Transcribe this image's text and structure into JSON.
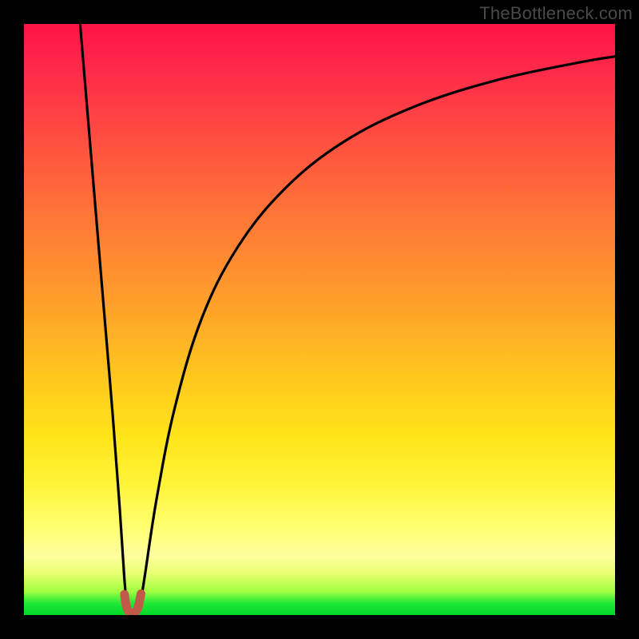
{
  "watermark": "TheBottleneck.com",
  "chart_data": {
    "type": "line",
    "title": "",
    "xlabel": "",
    "ylabel": "",
    "xlim": [
      0,
      100
    ],
    "ylim": [
      0,
      100
    ],
    "background_gradient": {
      "top_color": "#ff1446",
      "mid_color": "#ffe41a",
      "bottom_color": "#00d828",
      "meaning": "bottleneck severity (red=high, green=none)"
    },
    "series": [
      {
        "name": "left-branch",
        "stroke": "#000000",
        "x": [
          9.5,
          10.5,
          12.0,
          13.5,
          15.0,
          16.2,
          17.0,
          17.5
        ],
        "y": [
          100,
          88,
          70,
          52,
          34,
          18,
          6,
          0.5
        ]
      },
      {
        "name": "right-branch",
        "stroke": "#000000",
        "x": [
          19.5,
          20.5,
          22.5,
          25.5,
          30,
          36,
          44,
          54,
          66,
          80,
          94,
          100
        ],
        "y": [
          0.5,
          7,
          20,
          35,
          50,
          62,
          72,
          80,
          86,
          90.5,
          93.5,
          94.5
        ]
      },
      {
        "name": "valley-marker",
        "stroke": "#c25a4a",
        "shape": "u",
        "x": [
          17.0,
          17.4,
          18.0,
          18.7,
          19.3,
          19.8
        ],
        "y": [
          3.5,
          1.2,
          0.4,
          0.4,
          1.3,
          3.6
        ]
      }
    ],
    "note": "x and y are in percent of the plot area; y=0 is the bottom edge, y=100 is the top edge"
  }
}
